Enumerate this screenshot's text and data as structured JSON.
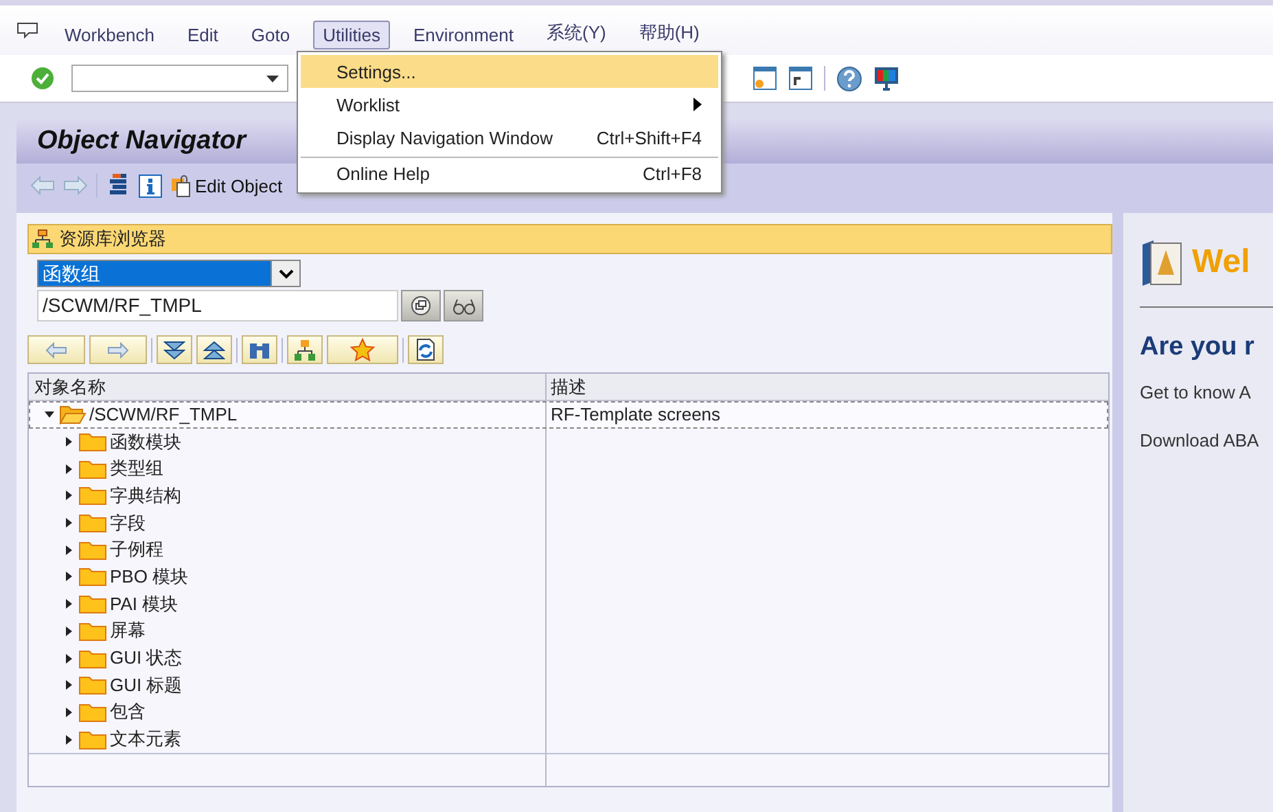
{
  "menubar": {
    "items": [
      {
        "label": "Workbench",
        "selected": false
      },
      {
        "label": "Edit",
        "selected": false
      },
      {
        "label": "Goto",
        "selected": false
      },
      {
        "label": "Utilities",
        "selected": true
      },
      {
        "label": "Environment",
        "selected": false
      },
      {
        "label": "系统(Y)",
        "selected": false
      },
      {
        "label": "帮助(H)",
        "selected": false
      }
    ]
  },
  "menu": {
    "items": [
      {
        "label": "Settings...",
        "submenu": false,
        "selected": true,
        "separator_before": false
      },
      {
        "label": "Worklist",
        "submenu": true,
        "selected": false,
        "separator_before": false
      },
      {
        "label": "Display Navigation Window",
        "shortcut": "Ctrl+Shift+F4",
        "submenu": false,
        "selected": false,
        "separator_before": false
      },
      {
        "label": "Online Help",
        "shortcut": "Ctrl+F8",
        "submenu": false,
        "selected": false,
        "separator_before": true
      }
    ]
  },
  "window": {
    "title": "Object Navigator"
  },
  "app_toolbar": {
    "edit_object": "Edit Object"
  },
  "browser": {
    "header": "资源库浏览器",
    "object_type": "函数组",
    "object_name": "/SCWM/RF_TMPL",
    "columns": [
      "对象名称",
      "描述"
    ],
    "tree": [
      {
        "name": "/SCWM/RF_TMPL",
        "description": "RF-Template screens",
        "expanded": true,
        "selected": true,
        "children": [
          {
            "name": "函数模块",
            "expanded": false,
            "selected": false
          },
          {
            "name": "类型组",
            "expanded": false,
            "selected": false
          },
          {
            "name": "字典结构",
            "expanded": false,
            "selected": false
          },
          {
            "name": "字段",
            "expanded": false,
            "selected": false
          },
          {
            "name": "子例程",
            "expanded": false,
            "selected": false
          },
          {
            "name": "PBO 模块",
            "expanded": false,
            "selected": false
          },
          {
            "name": "PAI 模块",
            "expanded": false,
            "selected": false
          },
          {
            "name": "屏幕",
            "expanded": false,
            "selected": false
          },
          {
            "name": "GUI 状态",
            "expanded": false,
            "selected": false
          },
          {
            "name": "GUI 标题",
            "expanded": false,
            "selected": false
          },
          {
            "name": "包含",
            "expanded": false,
            "selected": false
          },
          {
            "name": "文本元素",
            "expanded": false,
            "selected": false
          }
        ]
      }
    ]
  },
  "welcome": {
    "title": "Wel",
    "heading": "Are you r",
    "lines": [
      "Get to know A",
      "Download ABA"
    ]
  }
}
